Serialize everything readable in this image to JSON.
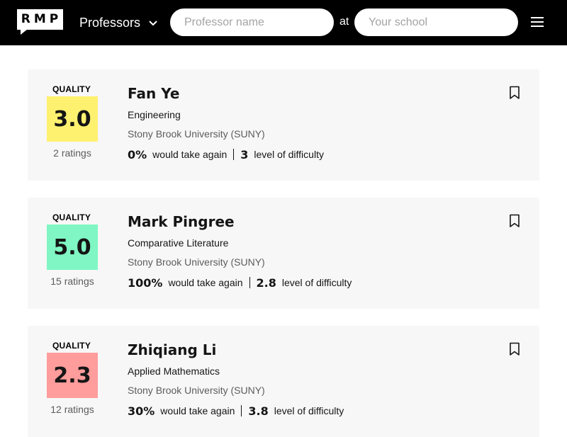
{
  "header": {
    "logo_text": "RMP",
    "nav_dropdown_label": "Professors",
    "professor_search_placeholder": "Professor name",
    "at_label": "at",
    "school_search_placeholder": "Your school"
  },
  "quality_label": "QUALITY",
  "would_take_again_label": "would take again",
  "difficulty_label": "level of difficulty",
  "professors": [
    {
      "name": "Fan Ye",
      "department": "Engineering",
      "school": "Stony Brook University (SUNY)",
      "quality": "3.0",
      "quality_color": "#fff170",
      "ratings": "2 ratings",
      "would_take_again": "0%",
      "difficulty": "3"
    },
    {
      "name": "Mark Pingree",
      "department": "Comparative Literature",
      "school": "Stony Brook University (SUNY)",
      "quality": "5.0",
      "quality_color": "#7ff6c3",
      "ratings": "15 ratings",
      "would_take_again": "100%",
      "difficulty": "2.8"
    },
    {
      "name": "Zhiqiang Li",
      "department": "Applied Mathematics",
      "school": "Stony Brook University (SUNY)",
      "quality": "2.3",
      "quality_color": "#ff9c9c",
      "ratings": "12 ratings",
      "would_take_again": "30%",
      "difficulty": "3.8"
    }
  ]
}
